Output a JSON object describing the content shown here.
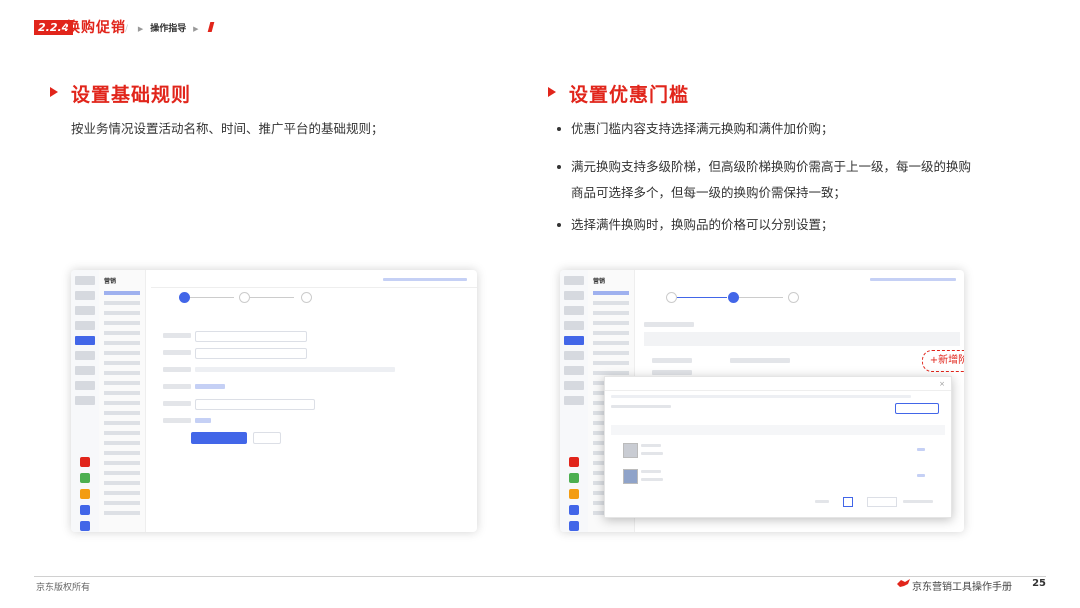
{
  "header": {
    "section_number": "2.2.4",
    "section_title": "换购促销",
    "breadcrumb": [
      "",
      "操作指导",
      ""
    ],
    "brand_line1": "",
    "brand_line2": ""
  },
  "left": {
    "heading": "设置基础规则",
    "description": "按业务情况设置活动名称、时间、推广平台的基础规则；",
    "screenshot": {
      "module": "营销",
      "page_title": "",
      "steps": [
        "",
        "",
        ""
      ],
      "section_label": "",
      "primary_button": "",
      "secondary_button": ""
    }
  },
  "right": {
    "heading": "设置优惠门槛",
    "bullets": [
      "优惠门槛内容支持选择满元换购和满件加价购；",
      "满元换购支持多级阶梯，但高级阶梯换购价需高于上一级，每一级的换购商品可选择多个，但每一级的换购价需保持一致；",
      "选择满件换购时，换购品的价格可以分别设置；"
    ],
    "screenshot": {
      "module": "营销",
      "page_title": "",
      "steps": [
        "",
        "",
        ""
      ],
      "add_tier_label": "+新增阶梯",
      "modal_title": "",
      "table_headers": [
        "",
        "",
        ""
      ],
      "rows": [
        {
          "id": "",
          "price": ""
        },
        {
          "id": "",
          "price": ""
        }
      ]
    }
  },
  "footer": {
    "left_text": "京东版权所有",
    "right_text": "京东营销工具操作手册",
    "page_number": "25",
    "watermark": ""
  },
  "colors": {
    "brand_red": "#e1251b",
    "ui_blue": "#4266e8"
  }
}
